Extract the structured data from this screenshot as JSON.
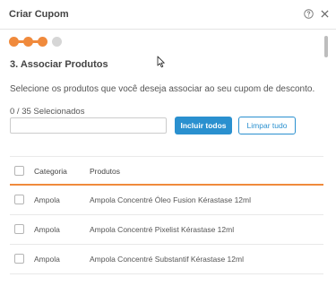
{
  "modal": {
    "title": "Criar Cupom",
    "help_icon": "question-circle-icon",
    "close_icon": "close-icon"
  },
  "steps": {
    "total": 4,
    "completed": 3,
    "active_color": "#f08a3c",
    "inactive_color": "#d6d6d6"
  },
  "section": {
    "title": "3. Associar Produtos",
    "description": "Selecione os produtos que você deseja associar ao seu cupom de desconto."
  },
  "selection": {
    "counter": "0 / 35 Selecionados",
    "search_value": "",
    "include_all_label": "Incluir todos",
    "clear_all_label": "Limpar tudo"
  },
  "table": {
    "headers": {
      "category": "Categoria",
      "products": "Produtos"
    },
    "rows": [
      {
        "category": "Ampola",
        "product": "Ampola Concentré Óleo Fusion Kérastase 12ml"
      },
      {
        "category": "Ampola",
        "product": "Ampola Concentré Pixelist Kérastase 12ml"
      },
      {
        "category": "Ampola",
        "product": "Ampola Concentré Substantif Kérastase 12ml"
      }
    ]
  },
  "colors": {
    "primary": "#2a90cf",
    "accent": "#f08a3c"
  }
}
